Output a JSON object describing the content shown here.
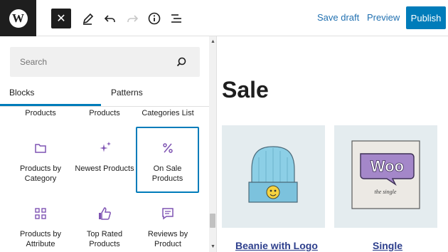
{
  "toolbar": {
    "logo_glyph": "W",
    "close_glyph": "✕",
    "save_draft_label": "Save draft",
    "preview_label": "Preview",
    "publish_label": "Publish"
  },
  "inserter": {
    "search_placeholder": "Search",
    "tabs": [
      {
        "label": "Blocks",
        "active": true
      },
      {
        "label": "Patterns",
        "active": false
      }
    ],
    "partial_row": [
      "Products",
      "Products",
      "Categories List"
    ],
    "blocks": [
      {
        "label": "Products by Category",
        "icon": "folder-icon"
      },
      {
        "label": "Newest Products",
        "icon": "sparkle-icon"
      },
      {
        "label": "On Sale Products",
        "icon": "percent-icon",
        "selected": true
      },
      {
        "label": "Products by Attribute",
        "icon": "grid-icon"
      },
      {
        "label": "Top Rated Products",
        "icon": "thumbs-up-icon"
      },
      {
        "label": "Reviews by Product",
        "icon": "comment-icon"
      }
    ]
  },
  "canvas": {
    "title": "Sale",
    "products": [
      {
        "name": "Beanie with Logo",
        "image": "beanie-image",
        "logo_text": ""
      },
      {
        "name": "Single",
        "image": "woo-album-image",
        "logo_text": "Woo",
        "sub_text": "the single"
      }
    ]
  },
  "colors": {
    "accent": "#007cba",
    "icon_purple": "#7f54b3",
    "link_blue": "#2271b1",
    "product_bg": "#e4ecef"
  }
}
